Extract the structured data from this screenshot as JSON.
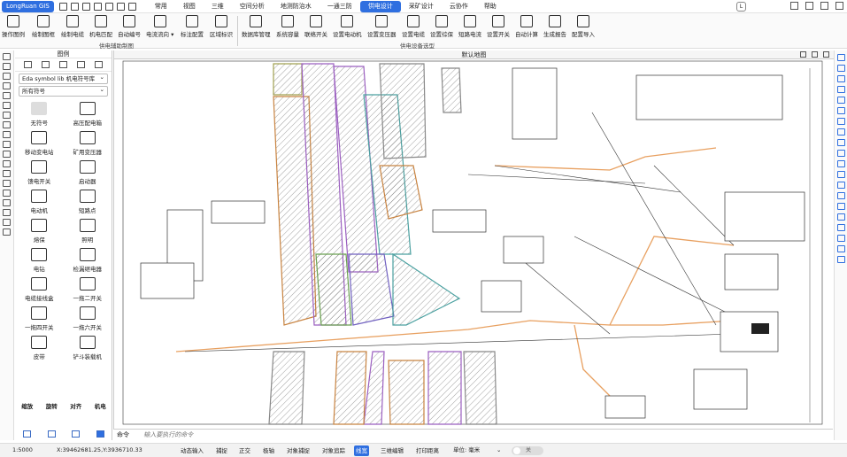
{
  "app": {
    "logo": "LongRuan GIS"
  },
  "menu": [
    "常用",
    "视图",
    "三维",
    "空间分析",
    "地测防治水",
    "一通三防",
    "供电设计",
    "采矿设计",
    "云协作",
    "帮助"
  ],
  "menu_active": "供电设计",
  "user_initial": "L",
  "ribbon": {
    "buttons": [
      "操作图例",
      "绘制图框",
      "绘制电缆",
      "机电匹配",
      "自动编号",
      "电流流向 ▾",
      "标注配置",
      "区域标识",
      "数据库管理",
      "系统容量",
      "联络开关",
      "设置电动机",
      "设置变压器",
      "设置电缆",
      "设置综保",
      "短路电流",
      "设置开关",
      "自动计算",
      "生成报告",
      "配置导入"
    ],
    "groups": [
      "供电辅助制图",
      "供电设备选型"
    ]
  },
  "legend": {
    "title": "图例",
    "library": "Eda symbol lib 机电符号库",
    "filter": "所有符号",
    "symbols": [
      "无符号",
      "高压配电箱",
      "移动变电站",
      "矿用变压器",
      "馈电开关",
      "启动器",
      "电动机",
      "短路点",
      "熔保",
      "照明",
      "电钻",
      "检漏继电器",
      "电缆接线盒",
      "一拖二开关",
      "一拖四开关",
      "一拖六开关",
      "皮带",
      "铲斗装载机"
    ],
    "actions": [
      "缩放",
      "旋转",
      "对齐",
      "机电"
    ]
  },
  "map": {
    "title": "默认地图"
  },
  "command": {
    "label": "命令",
    "placeholder": "输入要执行的命令"
  },
  "status": {
    "scale": "1:5000",
    "coords": "X:39462681.25,Y:3936710.33",
    "buttons": [
      "动态输入",
      "捕捉",
      "正交",
      "极轴",
      "对象捕捉",
      "对象追踪",
      "线宽",
      "三维编辑",
      "打印距离"
    ],
    "active": "线宽",
    "unit_label": "单位: 毫米",
    "toggle": "关"
  }
}
